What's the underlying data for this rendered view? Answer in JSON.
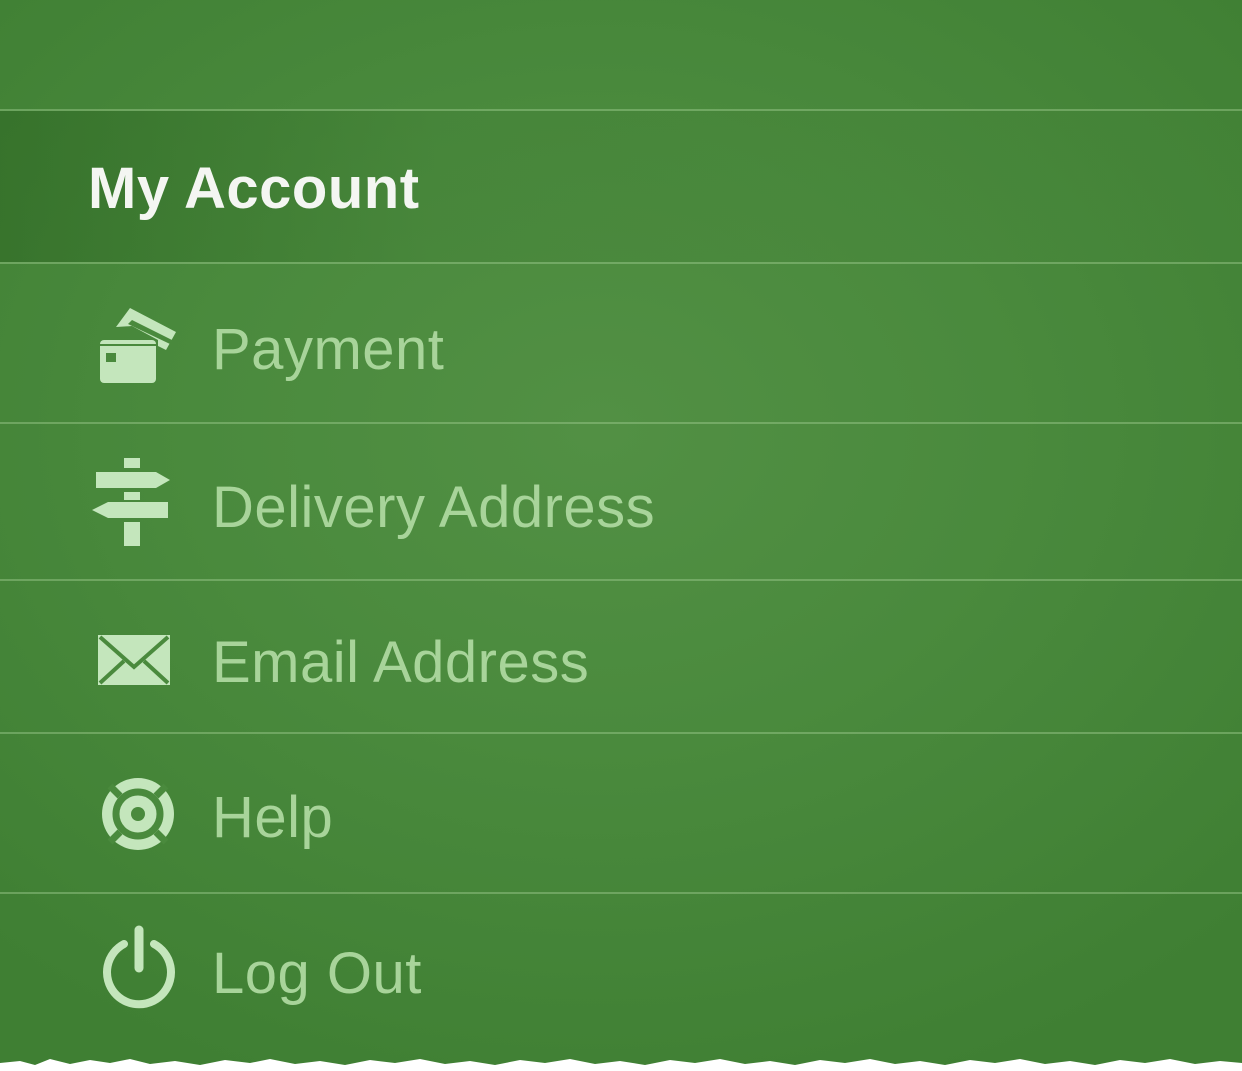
{
  "header": {
    "title": "My Account"
  },
  "menu": {
    "items": [
      {
        "label": "Payment",
        "icon": "credit-cards-icon"
      },
      {
        "label": "Delivery Address",
        "icon": "signpost-icon"
      },
      {
        "label": "Email Address",
        "icon": "envelope-icon"
      },
      {
        "label": "Help",
        "icon": "lifebuoy-icon"
      },
      {
        "label": "Log Out",
        "icon": "power-icon"
      }
    ]
  },
  "colors": {
    "background": "#4a8a3d",
    "header_text": "#f4f6f2",
    "item_text": "#a8d49a",
    "icon": "#c4e6bc"
  }
}
